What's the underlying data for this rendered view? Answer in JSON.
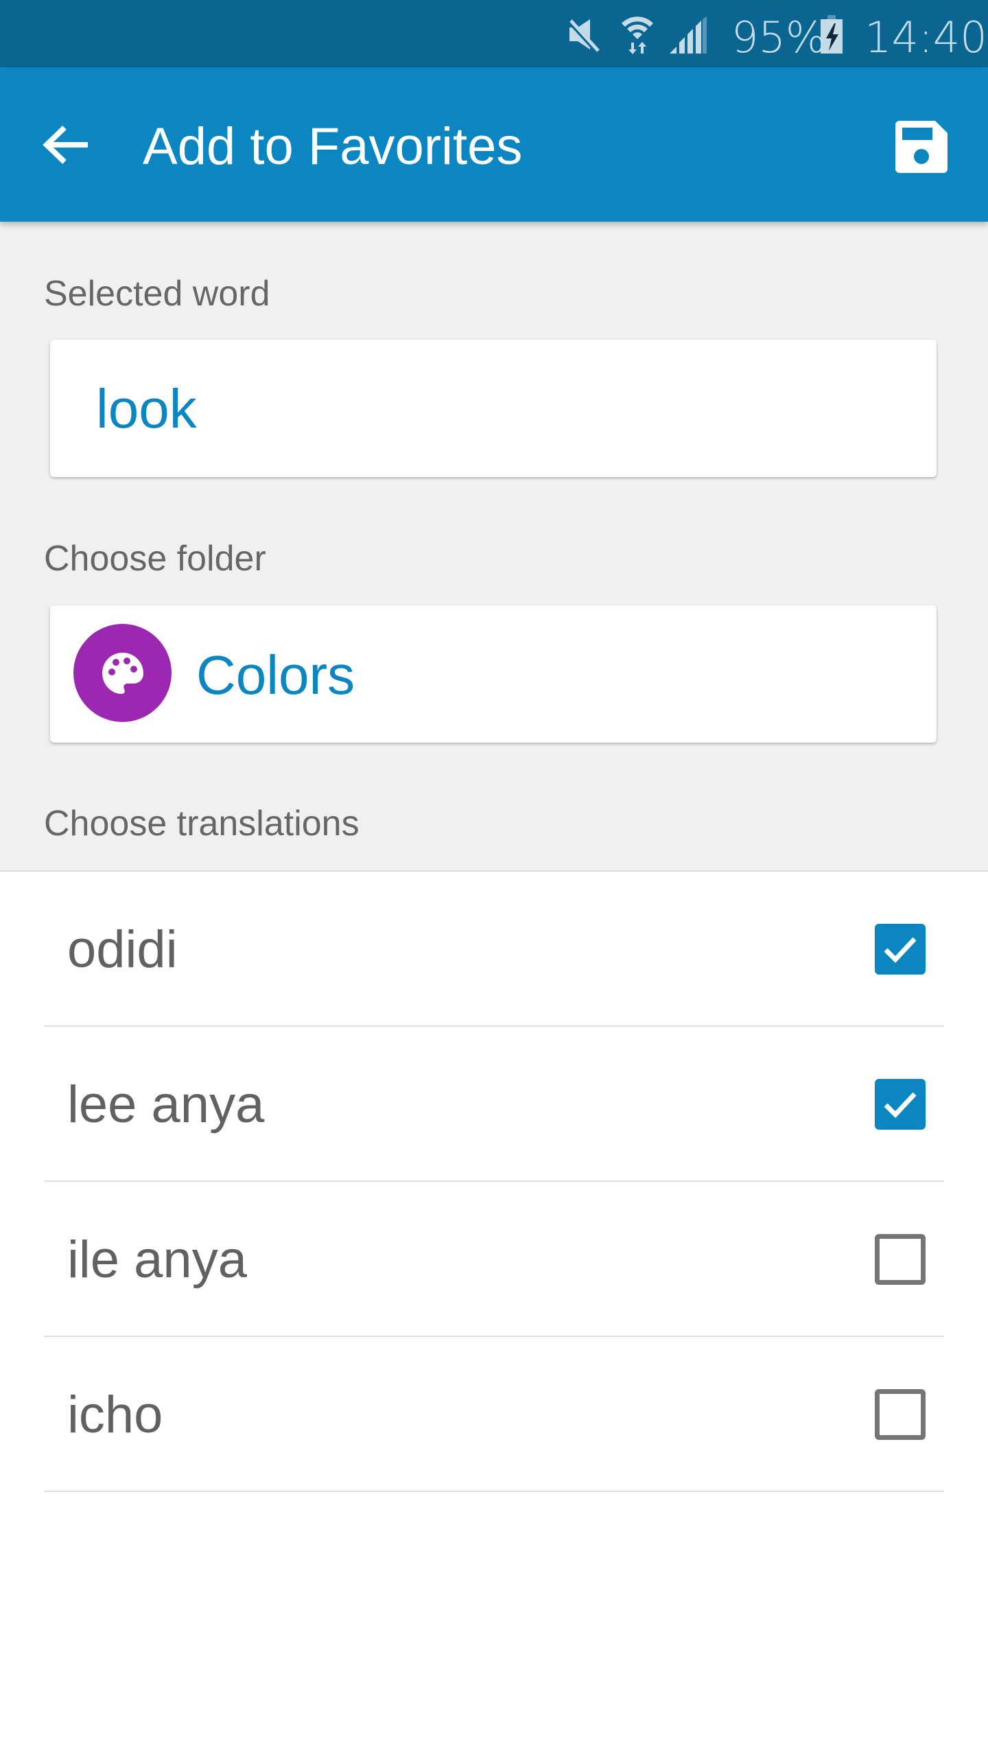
{
  "status_bar": {
    "battery": "95%",
    "time": "14:40",
    "icons": [
      "mute-icon",
      "wifi-icon",
      "signal-icon",
      "battery-charging-icon"
    ]
  },
  "app_bar": {
    "title": "Add to Favorites",
    "back_icon": "arrow-back-icon",
    "save_icon": "save-icon"
  },
  "selected_word": {
    "label": "Selected word",
    "value": "look"
  },
  "folder": {
    "label": "Choose folder",
    "name": "Colors",
    "icon": "palette-icon",
    "icon_color": "#9c27b0"
  },
  "translations": {
    "label": "Choose translations",
    "items": [
      {
        "text": "odidi",
        "checked": true
      },
      {
        "text": "lee anya",
        "checked": true
      },
      {
        "text": "ile anya",
        "checked": false
      },
      {
        "text": "icho",
        "checked": false
      }
    ]
  },
  "colors": {
    "accent": "#0c86c0",
    "status_bar": "#0a6690"
  }
}
